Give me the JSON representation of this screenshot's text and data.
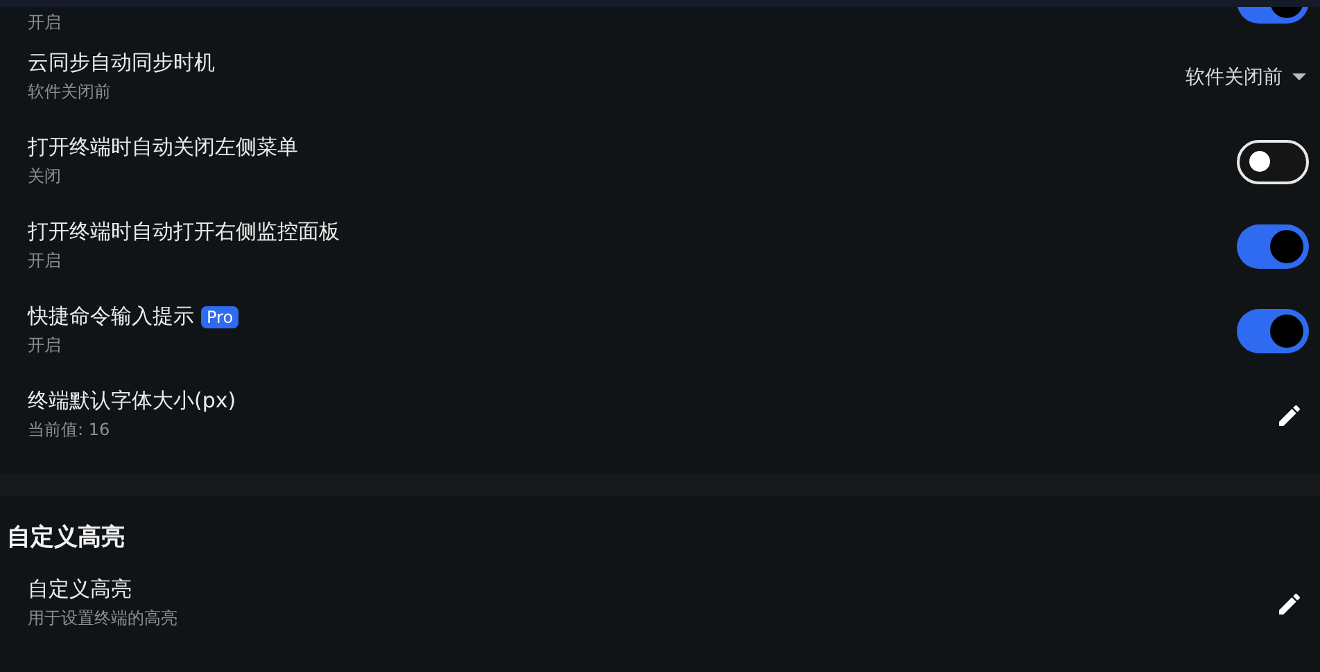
{
  "sections": [
    {
      "rows": [
        {
          "kind": "toggle",
          "subtitle": "开启",
          "on": true,
          "cut": true
        },
        {
          "kind": "select",
          "title": "云同步自动同步时机",
          "subtitle": "软件关闭前",
          "value": "软件关闭前"
        },
        {
          "kind": "toggle",
          "title": "打开终端时自动关闭左侧菜单",
          "subtitle": "关闭",
          "on": false
        },
        {
          "kind": "toggle",
          "title": "打开终端时自动打开右侧监控面板",
          "subtitle": "开启",
          "on": true
        },
        {
          "kind": "toggle",
          "title": "快捷命令输入提示",
          "badge": "Pro",
          "subtitle": "开启",
          "on": true
        },
        {
          "kind": "edit",
          "title": "终端默认字体大小(px)",
          "subtitle": "当前值: 16"
        }
      ]
    },
    {
      "title": "自定义高亮",
      "rows": [
        {
          "kind": "edit",
          "title": "自定义高亮",
          "subtitle": "用于设置终端的高亮"
        }
      ]
    }
  ]
}
